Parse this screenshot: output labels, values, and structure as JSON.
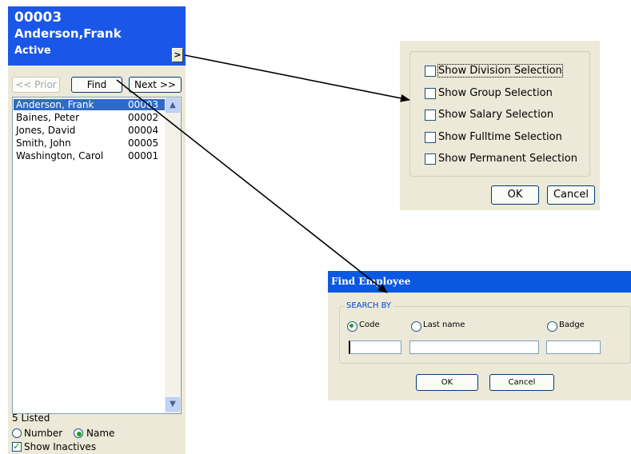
{
  "employee_panel": {
    "code": "00003",
    "name": "Anderson,Frank",
    "status": "Active",
    "expand_label": ">",
    "prior_label": "<< Prior",
    "find_label": "Find",
    "next_label": "Next >>",
    "list": [
      {
        "name": "Anderson, Frank",
        "code": "00003",
        "selected": true
      },
      {
        "name": "Baines, Peter",
        "code": "00002",
        "selected": false
      },
      {
        "name": "Jones, David",
        "code": "00004",
        "selected": false
      },
      {
        "name": "Smith, John",
        "code": "00005",
        "selected": false
      },
      {
        "name": "Washington, Carol",
        "code": "00001",
        "selected": false
      }
    ],
    "listed_count": "5 Listed",
    "sort_number_label": "Number",
    "sort_name_label": "Name",
    "sort_selected": "Name",
    "show_inactives_label": "Show Inactives",
    "show_inactives_checked": true
  },
  "options_popup": {
    "options": [
      {
        "label": "Show Division Selection",
        "checked": false
      },
      {
        "label": "Show Group Selection",
        "checked": false
      },
      {
        "label": "Show Salary Selection",
        "checked": false
      },
      {
        "label": "Show Fulltime Selection",
        "checked": false
      },
      {
        "label": "Show Permanent Selection",
        "checked": false
      }
    ],
    "ok_label": "OK",
    "cancel_label": "Cancel"
  },
  "find_dialog": {
    "title": "Find Employee",
    "group_label": "SEARCH BY",
    "search_options": [
      {
        "label": "Code",
        "checked": true
      },
      {
        "label": "Last name",
        "checked": false
      },
      {
        "label": "Badge",
        "checked": false
      }
    ],
    "code_value": "",
    "last_name_value": "",
    "badge_value": "",
    "ok_label": "OK",
    "cancel_label": "Cancel"
  },
  "colors": {
    "header_blue": "#1a57e8",
    "selection_blue": "#316ac5",
    "dialog_face": "#ece9d8"
  }
}
